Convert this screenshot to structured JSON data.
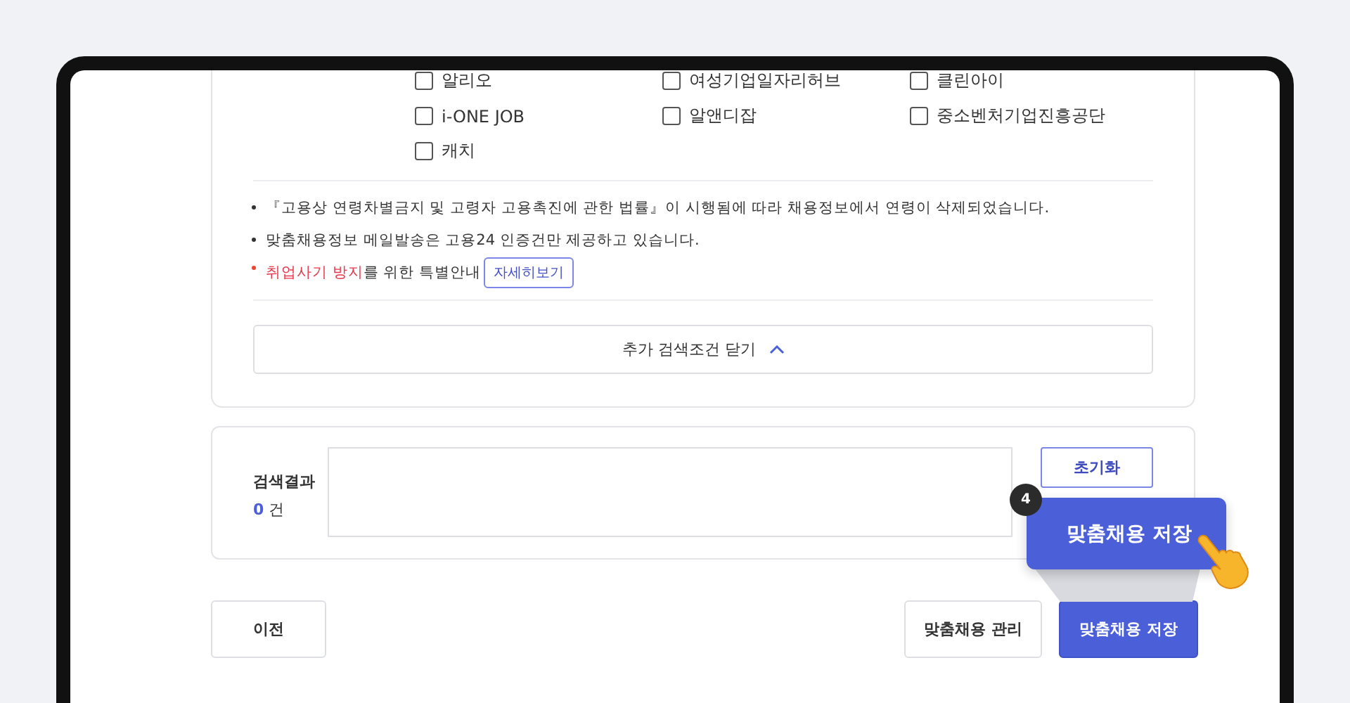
{
  "sites": [
    {
      "label": "알리오",
      "checked": false
    },
    {
      "label": "여성기업일자리허브",
      "checked": false
    },
    {
      "label": "클린아이",
      "checked": false
    },
    {
      "label": "i-ONE JOB",
      "checked": false
    },
    {
      "label": "알앤디잡",
      "checked": false
    },
    {
      "label": "중소벤처기업진흥공단",
      "checked": false
    },
    {
      "label": "캐치",
      "checked": false
    }
  ],
  "notes": [
    {
      "kind": "plain",
      "text": "『고용상 연령차별금지 및 고령자 고용촉진에 관한 법률』이 시행됨에 따라 채용정보에서 연령이 삭제되었습니다."
    },
    {
      "kind": "plain",
      "text": "맞춤채용정보 메일발송은 고용24 인증건만 제공하고 있습니다."
    },
    {
      "kind": "alert",
      "highlight": "취업사기 방지",
      "text": "를 위한 특별안내",
      "button": "자세히보기"
    }
  ],
  "collapse_button": "추가 검색조건 닫기",
  "result": {
    "label": "검색결과",
    "count": "0",
    "unit": "건",
    "reset_button": "초기화"
  },
  "footer": {
    "prev_button": "이전",
    "manage_button": "맞춤채용 관리",
    "save_button": "맞춤채용 저장"
  },
  "callout": {
    "step": "4",
    "text": "맞춤채용 저장"
  }
}
